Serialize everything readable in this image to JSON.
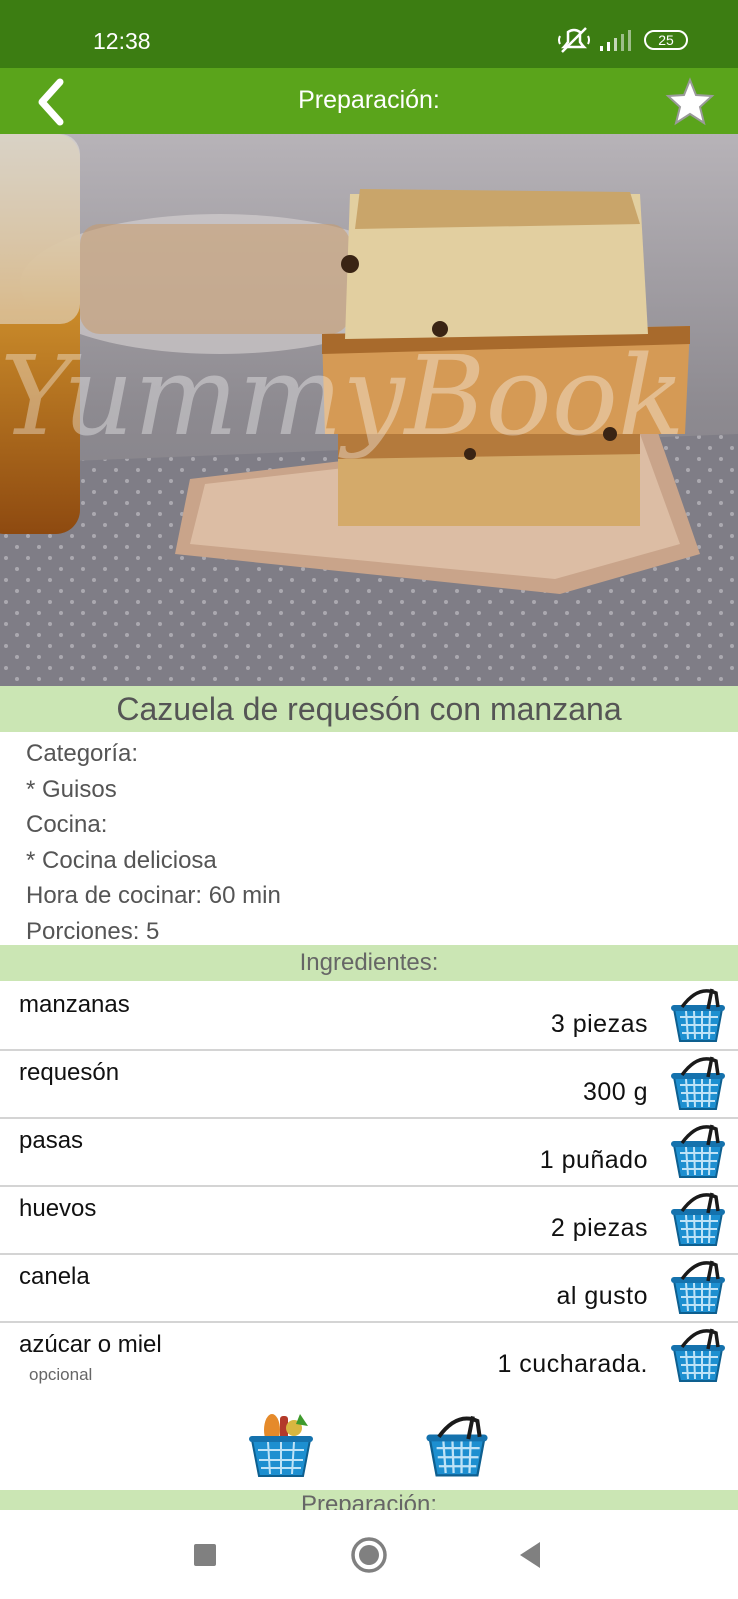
{
  "status_bar": {
    "time": "12:38",
    "battery": "25"
  },
  "app_bar": {
    "title": "Preparación:",
    "back_icon": "chevron-left-icon",
    "favorite_icon": "star-icon"
  },
  "hero": {
    "watermark": "YummyBook"
  },
  "recipe": {
    "title": "Cazuela de requesón con manzana",
    "category_label": "Categoría:",
    "category_value": "* Guisos",
    "cuisine_label": "Cocina:",
    "cuisine_value": "* Cocina deliciosa",
    "cook_time": "Hora de cocinar: 60 min",
    "servings": "Porciones: 5"
  },
  "ingredients_header": "Ingredientes:",
  "ingredients": [
    {
      "name": "manzanas",
      "qty": "3 piezas",
      "note": ""
    },
    {
      "name": "requesón",
      "qty": "300 g",
      "note": ""
    },
    {
      "name": "pasas",
      "qty": "1 puñado",
      "note": ""
    },
    {
      "name": "huevos",
      "qty": "2 piezas",
      "note": ""
    },
    {
      "name": "canela",
      "qty": "al gusto",
      "note": ""
    },
    {
      "name": "azúcar o miel",
      "qty": "1 cucharada.",
      "note": "opcional"
    }
  ],
  "preparation_header": "Preparación:",
  "colors": {
    "status_bar": "#3c7d12",
    "app_bar": "#5aa41b",
    "section_bg": "#cbe6b4",
    "basket_blue": "#1d8fd0"
  }
}
